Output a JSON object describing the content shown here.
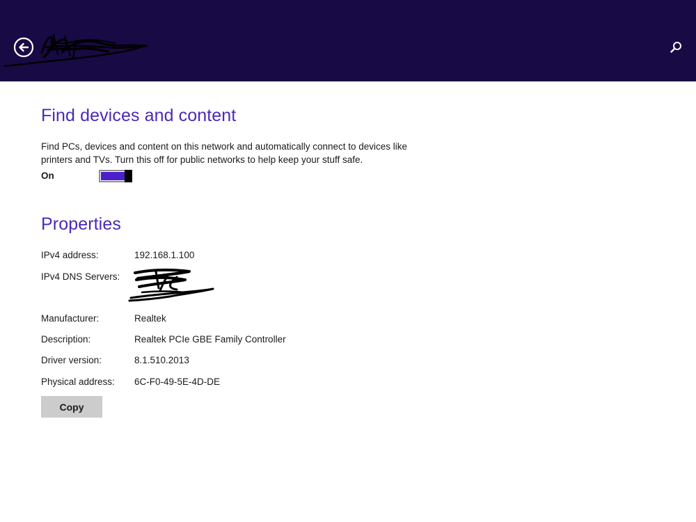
{
  "colors": {
    "header_bg": "#180a44",
    "accent": "#4a2ab8",
    "toggle_on": "#4b1fc9",
    "button_bg": "#cccccc"
  },
  "header": {
    "back_icon": "back-arrow-circle-icon",
    "search_icon": "search-icon"
  },
  "discovery": {
    "title": "Find devices and content",
    "description": "Find PCs, devices and content on this network and automatically connect to devices like printers and TVs. Turn this off for public networks to help keep your stuff safe.",
    "toggle_state": "On",
    "toggle_on": true
  },
  "properties": {
    "title": "Properties",
    "rows": [
      {
        "label": "IPv4 address:",
        "value": "192.168.1.100"
      },
      {
        "label": "IPv4 DNS Servers:",
        "value": ""
      },
      {
        "label": "Manufacturer:",
        "value": "Realtek"
      },
      {
        "label": "Description:",
        "value": "Realtek PCIe GBE Family Controller"
      },
      {
        "label": "Driver version:",
        "value": "8.1.510.2013"
      },
      {
        "label": "Physical address:",
        "value": "6C-F0-49-5E-4D-DE"
      }
    ],
    "copy_label": "Copy"
  }
}
